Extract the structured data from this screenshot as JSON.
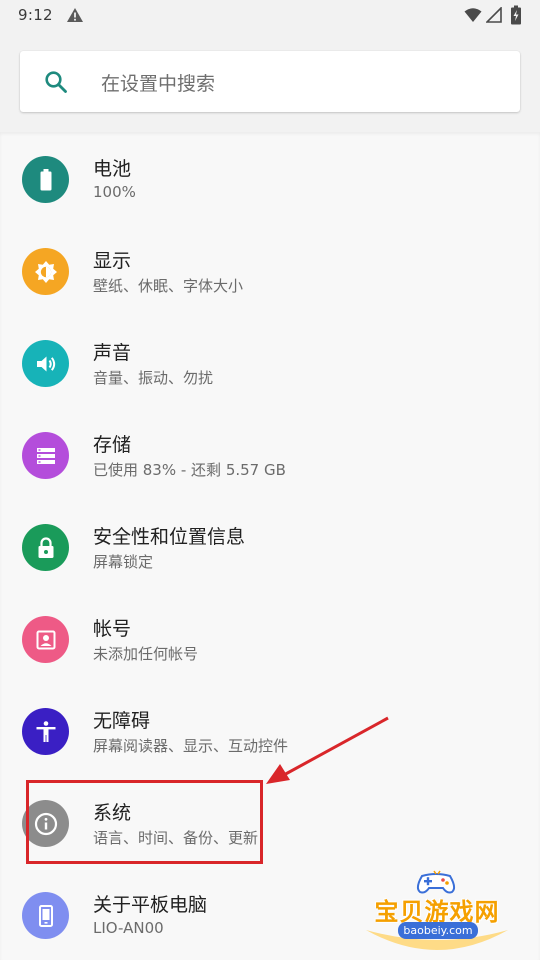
{
  "status_bar": {
    "time": "9:12",
    "icons": [
      "warning-icon",
      "wifi-icon",
      "signal-icon",
      "battery-icon"
    ]
  },
  "search": {
    "placeholder": "在设置中搜索",
    "icon": "search-icon"
  },
  "settings": [
    {
      "id": "battery",
      "title": "电池",
      "subtitle": "100%",
      "icon": "battery-icon",
      "color": "#1e8a7e"
    },
    {
      "id": "display",
      "title": "显示",
      "subtitle": "壁纸、休眠、字体大小",
      "icon": "brightness-icon",
      "color": "#f5a623"
    },
    {
      "id": "sound",
      "title": "声音",
      "subtitle": "音量、振动、勿扰",
      "icon": "volume-icon",
      "color": "#17b3b8"
    },
    {
      "id": "storage",
      "title": "存储",
      "subtitle": "已使用 83% - 还剩 5.57 GB",
      "icon": "storage-icon",
      "color": "#b44ddb"
    },
    {
      "id": "security",
      "title": "安全性和位置信息",
      "subtitle": "屏幕锁定",
      "icon": "lock-icon",
      "color": "#1a9b5a"
    },
    {
      "id": "accounts",
      "title": "帐号",
      "subtitle": "未添加任何帐号",
      "icon": "account-icon",
      "color": "#ee5a86"
    },
    {
      "id": "accessibility",
      "title": "无障碍",
      "subtitle": "屏幕阅读器、显示、互动控件",
      "icon": "accessibility-icon",
      "color": "#3a1fc4"
    },
    {
      "id": "system",
      "title": "系统",
      "subtitle": "语言、时间、备份、更新",
      "icon": "info-icon",
      "color": "#8c8c8c"
    },
    {
      "id": "about",
      "title": "关于平板电脑",
      "subtitle": "LIO-AN00",
      "icon": "tablet-icon",
      "color": "#7f8ef0"
    }
  ],
  "annotation": {
    "highlight_color": "#d9262a",
    "highlighted_item": "system"
  },
  "watermark": {
    "title": "宝贝游戏网",
    "url": "baobeiy.com"
  }
}
